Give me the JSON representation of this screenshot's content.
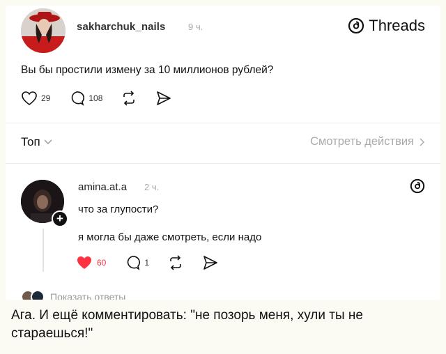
{
  "post": {
    "username": "sakharchuk_nails",
    "time": "9 ч.",
    "brand": "Threads",
    "text": "Вы бы простили измену за 10 миллионов рублей?",
    "likes": "29",
    "comments": "108"
  },
  "sort": {
    "label": "Топ",
    "view_activity": "Смотреть действия"
  },
  "reply": {
    "username": "amina.at.a",
    "time": "2 ч.",
    "line1": "что за глупости?",
    "line2": "я могла бы даже смотреть, если надо",
    "likes": "60",
    "comments": "1",
    "plus": "+",
    "like_color": "#ff3040"
  },
  "show_replies": "Показать ответы",
  "caption": "Ага. И ещё комментировать: \"не позорь меня, хули ты не стараешься!\""
}
